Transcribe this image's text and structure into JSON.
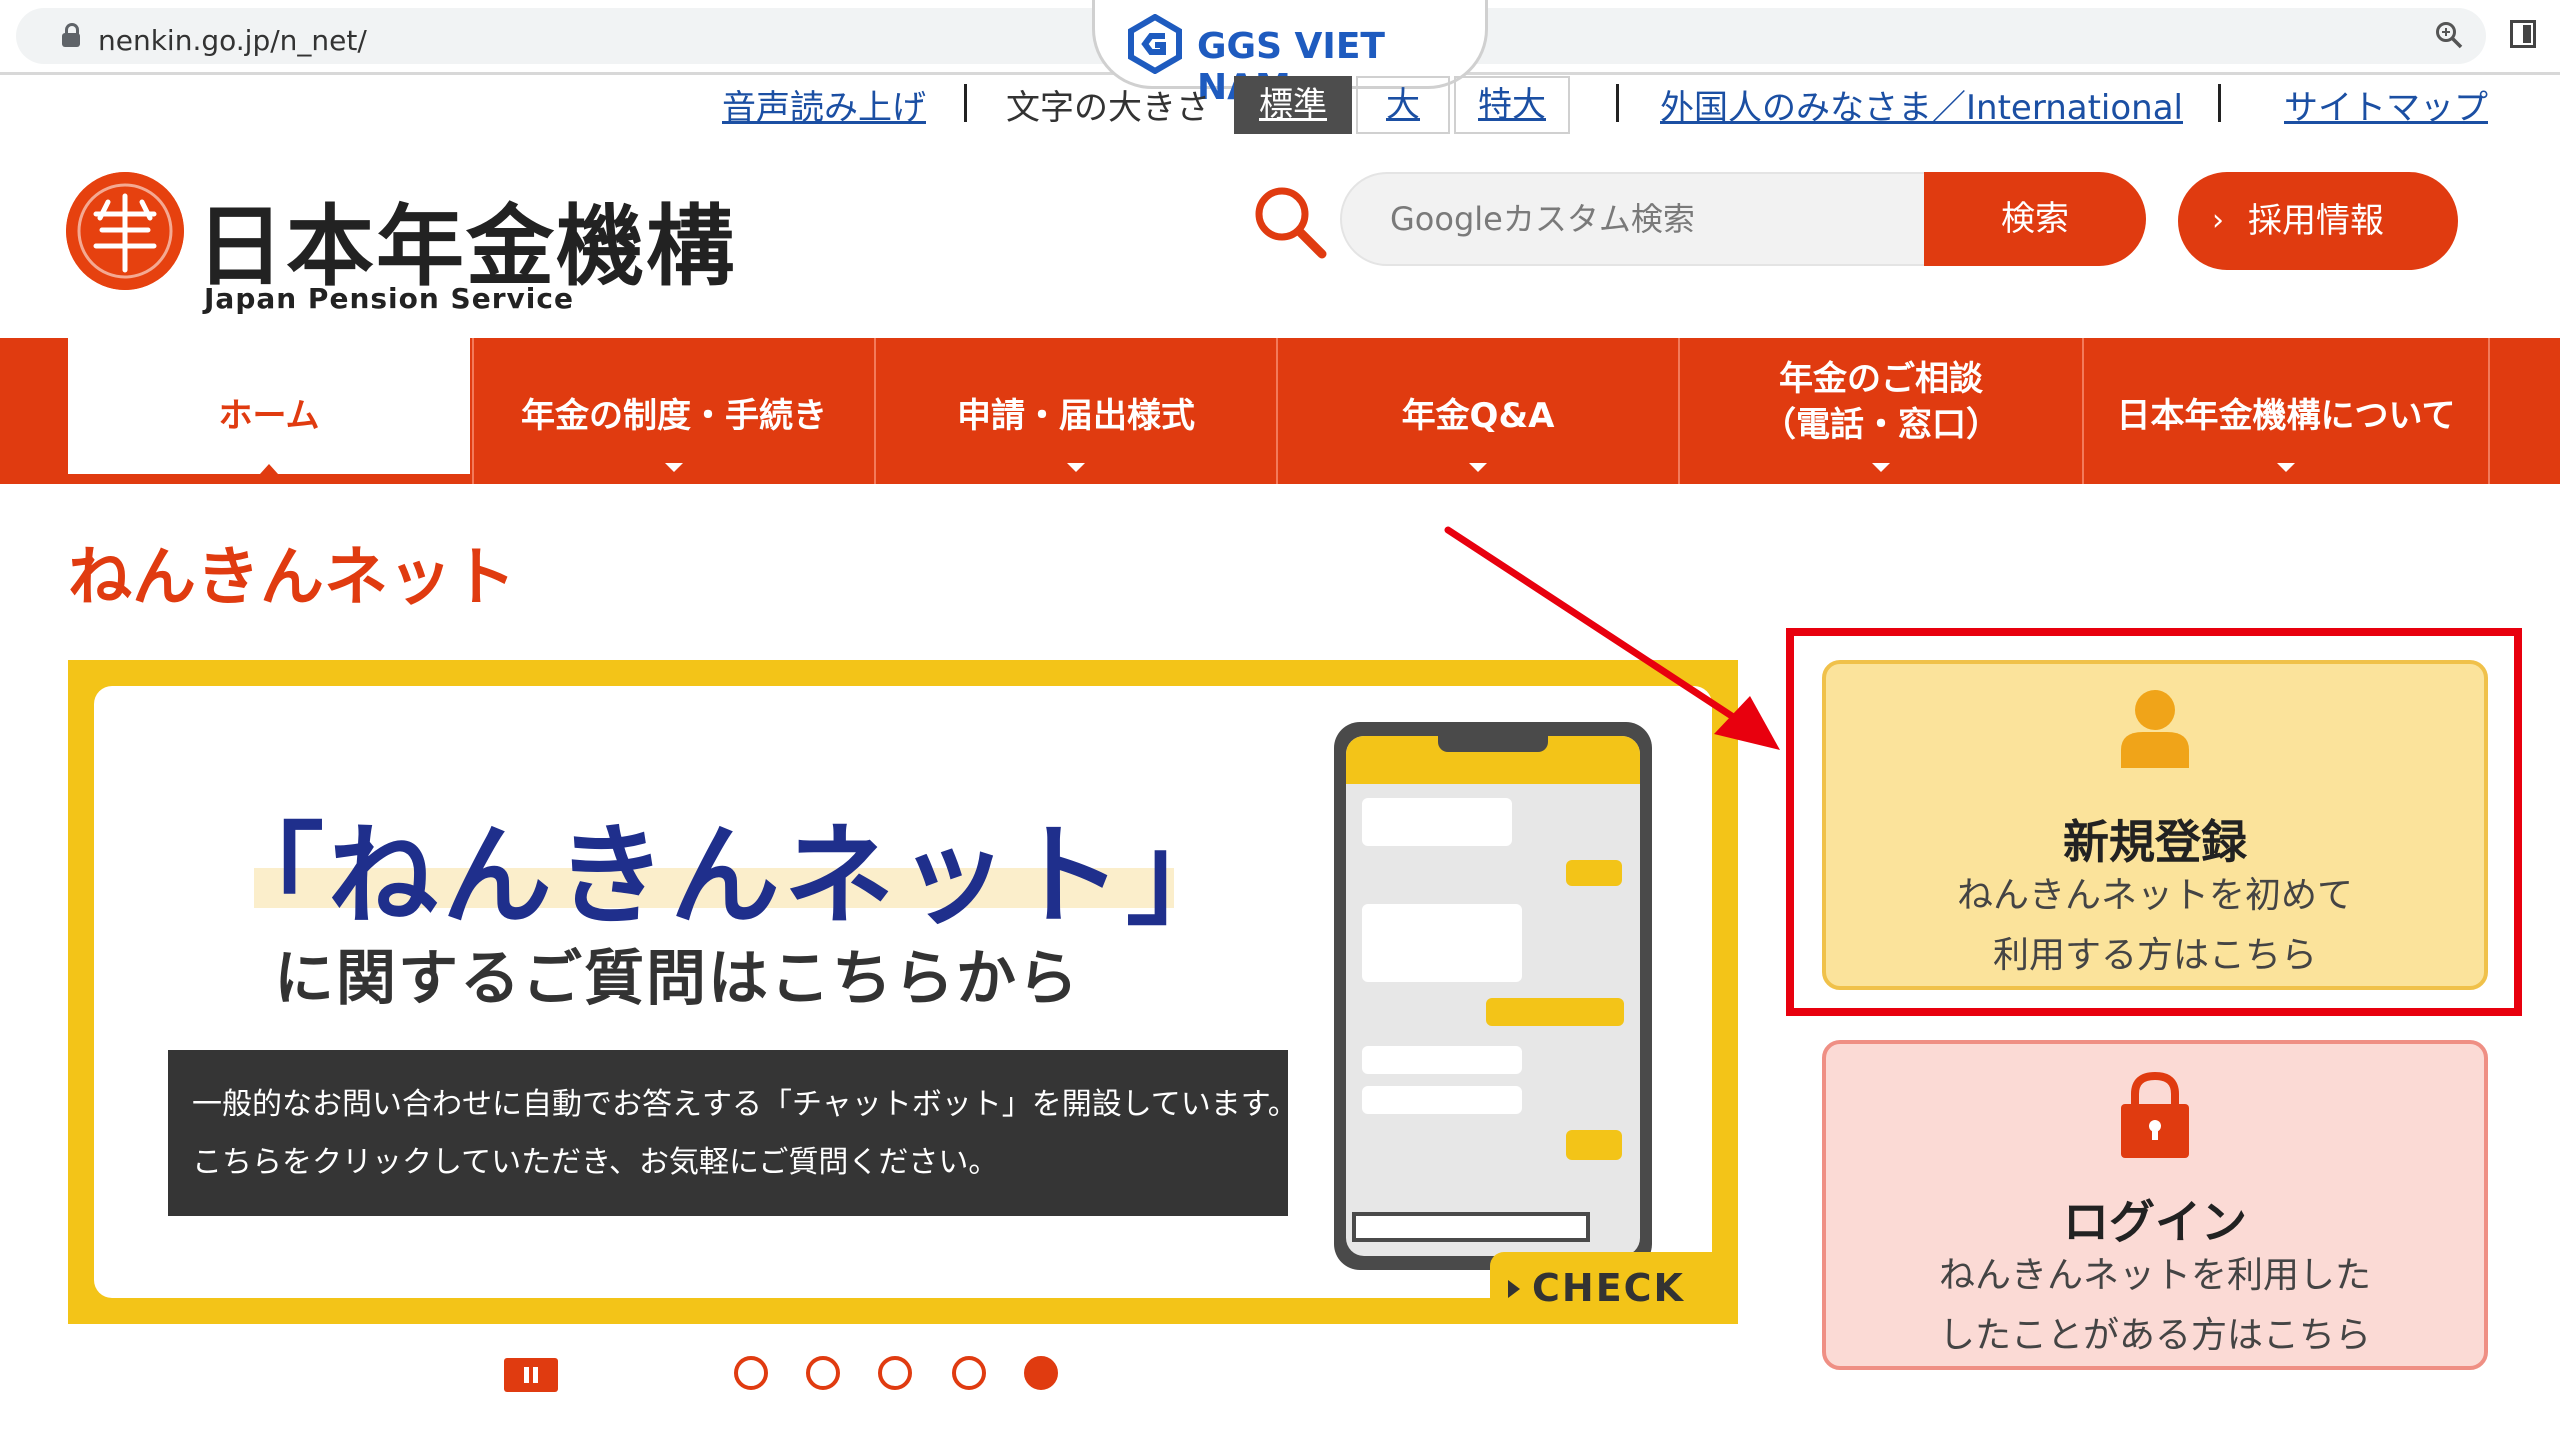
{
  "browser": {
    "url": "nenkin.go.jp/n_net/",
    "watermark": "GGS VIET NAM"
  },
  "utility": {
    "read_aloud": "音声読み上げ",
    "text_size_label": "文字の大きさ",
    "sizes": [
      "標準",
      "大",
      "特大"
    ],
    "active_size": "標準",
    "international": "外国人のみなさま／International",
    "sitemap": "サイトマップ"
  },
  "header": {
    "brand_jp": "日本年金機構",
    "brand_en": "Japan Pension Service",
    "search_placeholder": "Googleカスタム検索",
    "search_button": "検索",
    "recruit_chevron": "›",
    "recruit_button": "採用情報"
  },
  "nav": {
    "items": [
      {
        "label": "ホーム",
        "active": true
      },
      {
        "label": "年金の制度・手続き"
      },
      {
        "label": "申請・届出様式"
      },
      {
        "label": "年金Q&A"
      },
      {
        "label_line1": "年金のご相談",
        "label_line2": "（電話・窓口）"
      },
      {
        "label": "日本年金機構について"
      }
    ]
  },
  "page": {
    "title": "ねんきんネット"
  },
  "banner": {
    "title": "「ねんきんネット」",
    "subtitle": "に関するご質問はこちらから",
    "box_line1": "一般的なお問い合わせに自動でお答えする「チャットボット」を開設しています。",
    "box_line2": "こちらをクリックしていただき、お気軽にご質問ください。",
    "check_label": "CHECK"
  },
  "carousel": {
    "slide_count": 5,
    "active_index": 5
  },
  "cards": {
    "register": {
      "title": "新規登録",
      "desc_line1": "ねんきんネットを初めて",
      "desc_line2": "利用する方はこちら"
    },
    "login": {
      "title": "ログイン",
      "desc_line1": "ねんきんネットを利用した",
      "desc_line2": "したことがある方はこちら"
    }
  },
  "colors": {
    "brand_red": "#e03b10",
    "banner_yellow": "#f3c418",
    "banner_navy": "#1f2f8c",
    "register_card": "#fbe39b",
    "login_card": "#fbdad5",
    "annotation_red": "#e8000e",
    "link_blue": "#1b4fa3"
  },
  "icons": [
    "lock-icon",
    "zoom-icon",
    "side-panel-icon",
    "ggs-logo",
    "brand-logo",
    "search-icon",
    "person-icon",
    "padlock-icon",
    "pause-icon",
    "arrow-annotation"
  ]
}
